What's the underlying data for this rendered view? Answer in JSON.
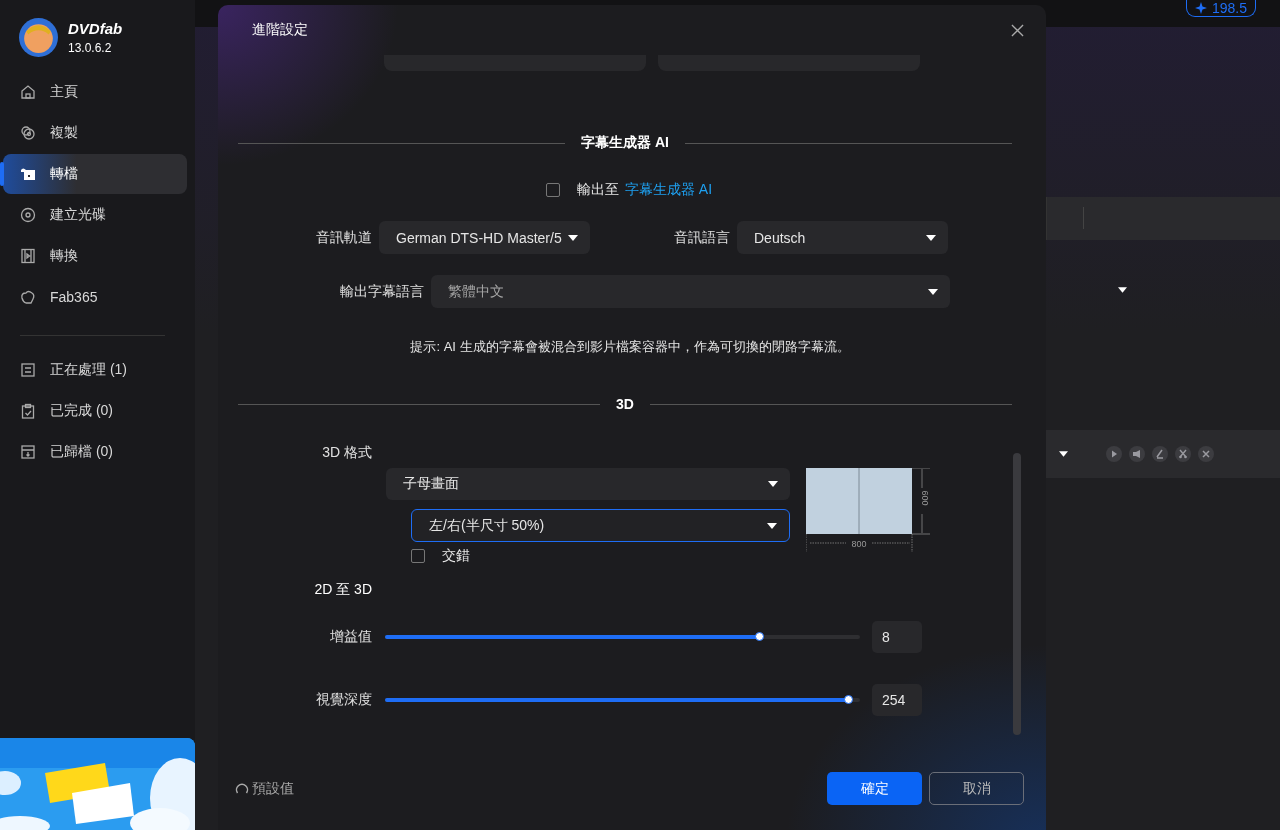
{
  "app": {
    "name": "DVDfab",
    "version": "13.0.6.2"
  },
  "sidebar": {
    "items": [
      {
        "label": "主頁",
        "selected": false
      },
      {
        "label": "複製",
        "selected": false
      },
      {
        "label": "轉檔",
        "selected": true
      },
      {
        "label": "建立光碟",
        "selected": false
      },
      {
        "label": "轉換",
        "selected": false
      },
      {
        "label": "Fab365",
        "selected": false
      }
    ],
    "queues": [
      {
        "label": "正在處理 (1)",
        "selected": false
      },
      {
        "label": "已完成 (0)",
        "selected": false
      },
      {
        "label": "已歸檔 (0)",
        "selected": false
      }
    ]
  },
  "top_bar": {
    "credits": "198.5"
  },
  "dialog": {
    "title": "進階設定",
    "subtitle_section": {
      "title": "字幕生成器 AI",
      "export": {
        "label": "輸出至",
        "link": "字幕生成器 AI",
        "checked": false
      },
      "audio_track": {
        "label": "音訊軌道",
        "value": "German DTS-HD Master/5"
      },
      "audio_language": {
        "label": "音訊語言",
        "value": "Deutsch"
      },
      "output_language": {
        "label": "輸出字幕語言",
        "value": "繁體中文"
      },
      "hint": "提示: AI 生成的字幕會被混合到影片檔案容器中，作為可切換的閉路字幕流。"
    },
    "three_d": {
      "title": "3D",
      "format_label": "3D 格式",
      "format": "子母畫面",
      "layout": "左/右(半尺寸 50%)",
      "interlace": {
        "label": "交錯",
        "checked": false
      },
      "preview": {
        "width_label": "800",
        "height_label": "600"
      },
      "conversion_title": "2D 至 3D",
      "sliders": [
        {
          "label": "增益值",
          "level": 0.79,
          "value": "8"
        },
        {
          "label": "視覺深度",
          "level": 0.977,
          "value": "254"
        }
      ]
    },
    "footer": {
      "reset": "預設值",
      "buttons": [
        {
          "label": "確定",
          "kind": "primary"
        },
        {
          "label": "取消",
          "kind": "secondary"
        }
      ]
    }
  }
}
